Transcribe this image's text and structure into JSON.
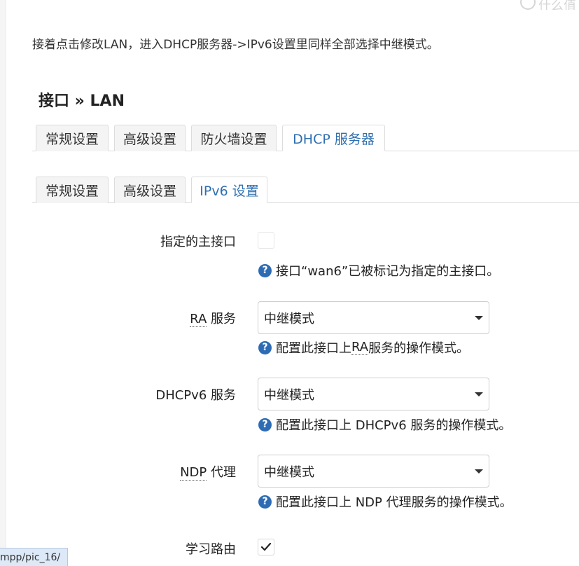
{
  "intro_text": "接着点击修改LAN，进入DHCP服务器->IPv6设置里同样全部选择中继模式。",
  "interface_title": "接口 » LAN",
  "main_tabs": [
    {
      "label": "常规设置"
    },
    {
      "label": "高级设置"
    },
    {
      "label": "防火墙设置"
    },
    {
      "label": "DHCP 服务器",
      "active": true
    }
  ],
  "sub_tabs": [
    {
      "label": "常规设置"
    },
    {
      "label": "高级设置"
    },
    {
      "label": "IPv6 设置",
      "active": true
    }
  ],
  "form": {
    "master": {
      "label": "指定的主接口",
      "checked": false,
      "help": "接口“wan6”已被标记为指定的主接口。"
    },
    "ra": {
      "label_abbr": "RA",
      "label_rest": " 服务",
      "value": "中继模式",
      "help_prefix": "配置此接口上 ",
      "help_abbr": "RA",
      "help_suffix": " 服务的操作模式。"
    },
    "dhcpv6": {
      "label": "DHCPv6 服务",
      "value": "中继模式",
      "help": "配置此接口上 DHCPv6 服务的操作模式。"
    },
    "ndp": {
      "label_abbr": "NDP",
      "label_rest": " 代理",
      "value": "中继模式",
      "help": "配置此接口上 NDP 代理服务的操作模式。"
    },
    "learn_routes": {
      "label": "学习路由",
      "checked": true
    }
  },
  "status_url": "mpp/pic_16/",
  "icons": {
    "help": "question-circle-icon",
    "dropdown": "caret-down-icon",
    "check": "check-icon"
  },
  "colors": {
    "active_tab_text": "#2f6fb0",
    "help_icon": "#2d6cb4",
    "status_bar_bg": "#dde9f7"
  }
}
